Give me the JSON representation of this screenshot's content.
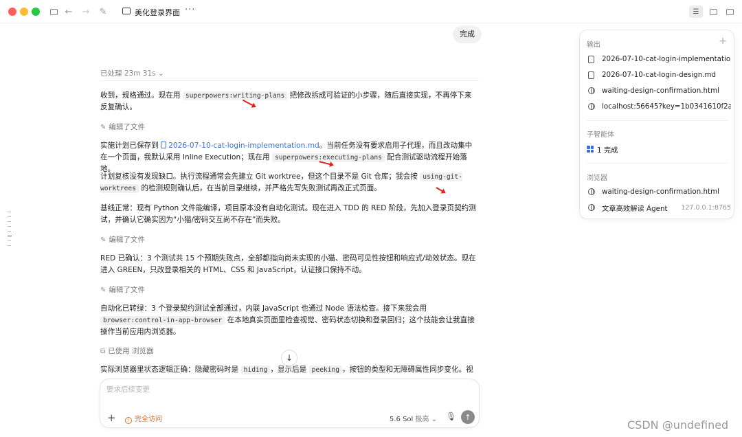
{
  "window": {
    "title": "美化登录界面",
    "more_label": "···"
  },
  "conversation": {
    "user_message": "完成",
    "processed_label": "已处理 23m 31s ⌄",
    "paragraphs": [
      {
        "pre": "收到，规格通过。现在用 ",
        "code": "superpowers:writing-plans",
        "post": " 把修改拆成可验证的小步骤，随后直接实现，不再停下来反复确认。"
      },
      {
        "pre": "实施计划已保存到 ",
        "link": "2026-07-10-cat-login-implementation.md",
        "mid": "。当前任务没有要求启用子代理，而且改动集中在一个页面，我默认采用 Inline Execution；现在用 ",
        "code": "superpowers:executing-plans",
        "post": " 配合测试驱动流程开始落地。"
      },
      {
        "pre": "计划复核没有发现缺口。执行流程通常会先建立 Git worktree，但这个目录不是 Git 仓库；我会按 ",
        "code": "using-git-worktrees",
        "post": " 的检测规则确认后，在当前目录继续，并严格先写失败测试再改正式页面。"
      },
      {
        "text": "基线正常：现有 Python 文件能编译，项目原本没有自动化测试。现在进入 TDD 的 RED 阶段，先加入登录页契约测试，并确认它确实因为“小猫/密码交互尚不存在”而失败。"
      },
      {
        "text": "RED 已确认：3 个测试共 15 个预期失败点，全部都指向尚未实现的小猫、密码可见性按钮和响应式/动效状态。现在进入 GREEN，只改登录相关的 HTML、CSS 和 JavaScript，认证接口保持不动。"
      },
      {
        "pre": "自动化已转绿：3 个登录契约测试全部通过，内联 JavaScript 也通过 Node 语法检查。接下来我会用 ",
        "code": "browser:control-in-app-browser",
        "post": " 在本地真实页面里检查视觉、密码状态切换和登录回归；这个技能会让我直接操作当前应用内浏览器。"
      },
      {
        "pre": "实际浏览器里状态逻辑正确：隐藏密码时是 ",
        "code": "hiding",
        "mid": "，显示后是 ",
        "code2": "peeking",
        "post": "，按钮的类型和无障碍属性同步变化。视觉"
      }
    ],
    "edited_label": "编辑了文件",
    "browser_used_label": "已使用 浏览器"
  },
  "composer": {
    "placeholder": "要求后续变更",
    "add_label": "+",
    "access_label": "完全访问",
    "model_label": "5.6 Sol",
    "effort_label": "极高 ⌄",
    "mic_label": "🎙",
    "send_label": "↑",
    "scroll_down_label": "↓"
  },
  "panel": {
    "outputs_title": "输出",
    "add_label": "+",
    "outputs": [
      {
        "icon": "document-icon",
        "label": "2026-07-10-cat-login-implementatio"
      },
      {
        "icon": "document-icon",
        "label": "2026-07-10-cat-login-design.md"
      },
      {
        "icon": "globe-icon",
        "label": "waiting-design-confirmation.html"
      },
      {
        "icon": "globe-icon",
        "label": "localhost:56645?key=1b0341610f2a"
      }
    ],
    "agents_title": "子智能体",
    "agents_status": "1 完成",
    "browser_title": "浏览器",
    "browser_items": [
      {
        "icon": "globe-icon",
        "label": "waiting-design-confirmation.html",
        "addr": ""
      },
      {
        "icon": "globe-icon",
        "label": "文章高效解读 Agent",
        "addr": "127.0.0.1:8765"
      }
    ]
  },
  "watermark": "CSDN @undefined",
  "colors": {
    "accent": "#3a6fd8",
    "warning": "#d9722c",
    "annotation_arrow": "#d9261c"
  }
}
